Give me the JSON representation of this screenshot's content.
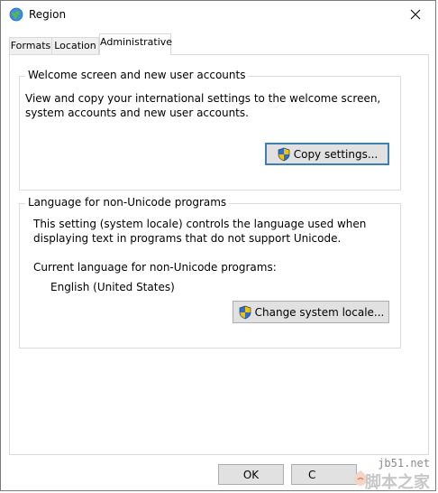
{
  "window": {
    "title": "Region",
    "icon": "globe-icon",
    "close_icon": "close-icon"
  },
  "tabs": [
    {
      "label": "Formats"
    },
    {
      "label": "Location"
    },
    {
      "label": "Administrative",
      "active": true
    }
  ],
  "welcome_group": {
    "title": "Welcome screen and new user accounts",
    "description": "View and copy your international settings to the welcome screen, system accounts and new user accounts.",
    "button_label": "Copy settings...",
    "button_icon": "uac-shield-icon"
  },
  "nonunicode_group": {
    "title": "Language for non-Unicode programs",
    "description": "This setting (system locale) controls the language used when displaying text in programs that do not support Unicode.",
    "current_label": "Current language for non-Unicode programs:",
    "current_value": "English (United States)",
    "button_label": "Change system locale...",
    "button_icon": "uac-shield-icon"
  },
  "footer": {
    "ok_label": "OK",
    "cancel_label_visible": "C"
  },
  "watermark": {
    "site": "jb51.net",
    "name": "脚本之家"
  }
}
